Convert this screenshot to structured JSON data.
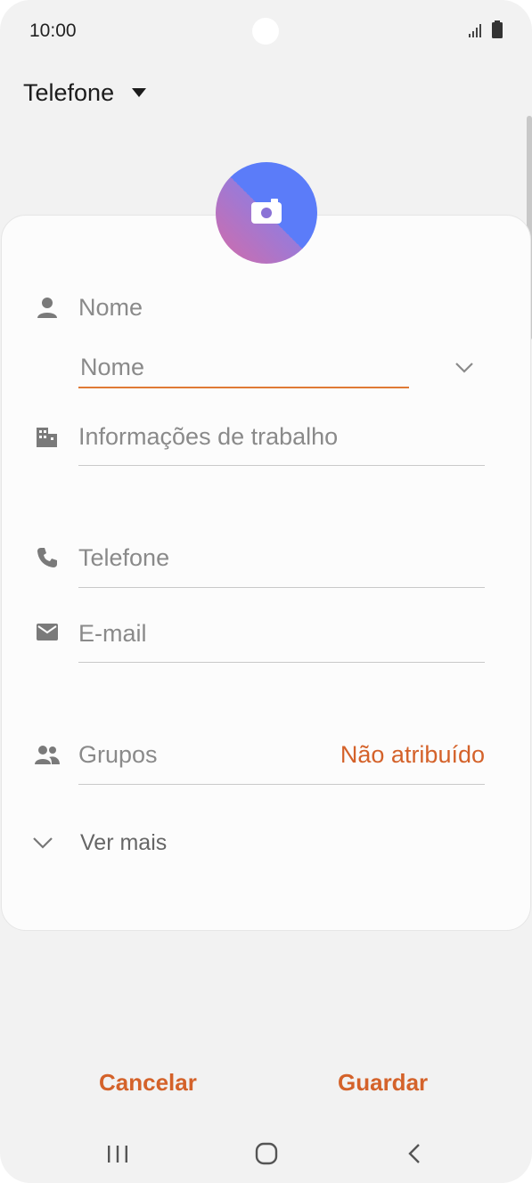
{
  "status_bar": {
    "time": "10:00"
  },
  "header": {
    "account_label": "Telefone"
  },
  "form": {
    "name_section_label": "Nome",
    "name_placeholder": "Nome",
    "work_label": "Informações de trabalho",
    "phone_label": "Telefone",
    "email_label": "E-mail",
    "groups_label": "Grupos",
    "groups_value": "Não atribuído",
    "see_more_label": "Ver mais"
  },
  "actions": {
    "cancel_label": "Cancelar",
    "save_label": "Guardar"
  },
  "colors": {
    "accent": "#d4622a",
    "active_underline": "#e07a35",
    "avatar_gradient_start": "#5b7cf9",
    "avatar_gradient_end": "#c86bb0"
  },
  "icons": {
    "status": [
      "signal-icon",
      "battery-icon"
    ],
    "rows": [
      "person-icon",
      "building-icon",
      "phone-icon",
      "mail-icon",
      "group-icon"
    ],
    "nav": [
      "recent-apps-icon",
      "home-icon",
      "back-icon"
    ]
  }
}
